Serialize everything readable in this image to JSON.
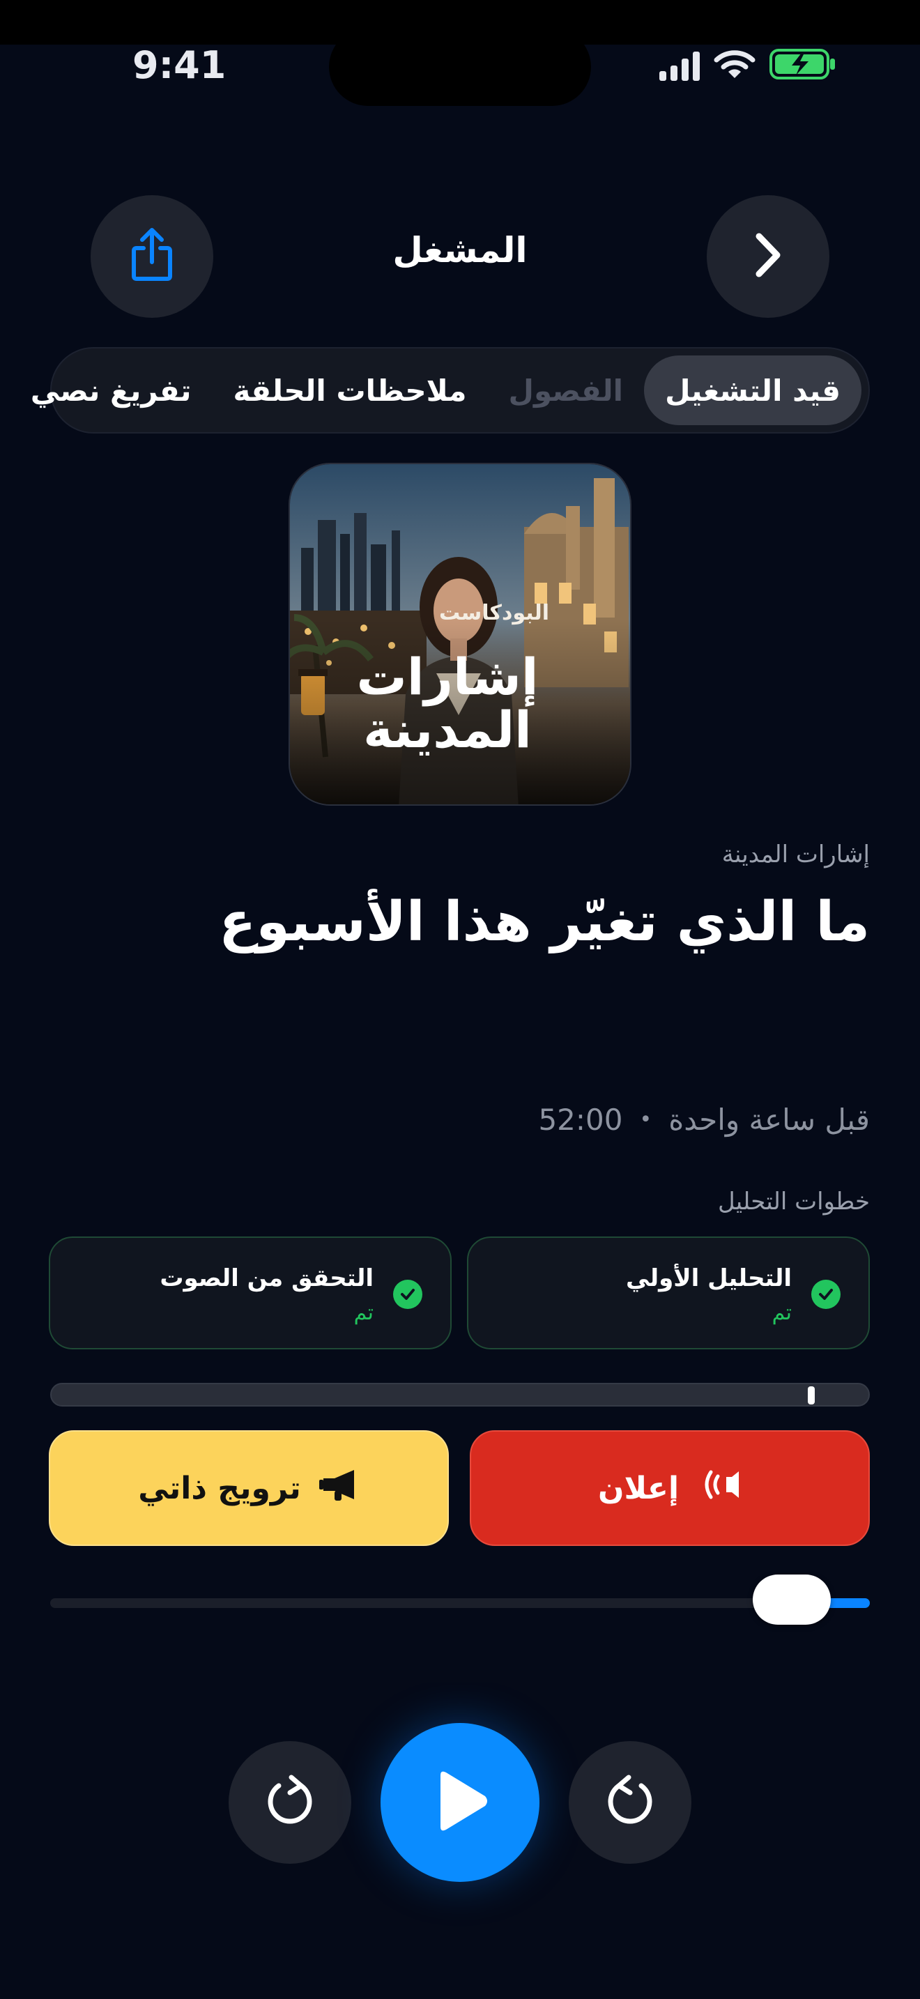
{
  "status_bar": {
    "time": "9:41",
    "icons": [
      "cellular-signal-icon",
      "wifi-icon",
      "battery-charging-icon"
    ]
  },
  "header": {
    "title": "المشغل",
    "share_icon": "share-icon",
    "back_icon": "chevron-right-icon"
  },
  "tabs": [
    {
      "label": "قيد التشغيل",
      "active": true
    },
    {
      "label": "الفصول",
      "disabled": true
    },
    {
      "label": "ملاحظات الحلقة"
    },
    {
      "label": "تفريغ نصي"
    }
  ],
  "artwork": {
    "subtitle": "البودكاست",
    "title_line1": "إشارات",
    "title_line2": "المدينة"
  },
  "episode": {
    "show": "إشارات المدينة",
    "title": "ما الذي تغيّر هذا الأسبوع",
    "published": "قبل ساعة واحدة",
    "separator": "•",
    "duration": "52:00"
  },
  "analysis": {
    "label": "خطوات التحليل",
    "steps": [
      {
        "label": "التحليل الأولي",
        "status": "تم"
      },
      {
        "label": "التحقق من الصوت",
        "status": "تم"
      }
    ]
  },
  "timeline": {
    "marker_fraction": 0.07
  },
  "segments": {
    "ad_label": "إعلان",
    "promo_label": "ترويج ذاتي"
  },
  "playback": {
    "progress_fraction": 0.07
  },
  "controls": {
    "skip_back_icon": "rotate-back-icon",
    "play_icon": "play-icon",
    "skip_forward_icon": "rotate-forward-icon"
  },
  "colors": {
    "accent": "#0a8cff",
    "success": "#22c55e",
    "ad": "#d92b1f",
    "promo": "#fcd35b",
    "background": "#050a18"
  }
}
